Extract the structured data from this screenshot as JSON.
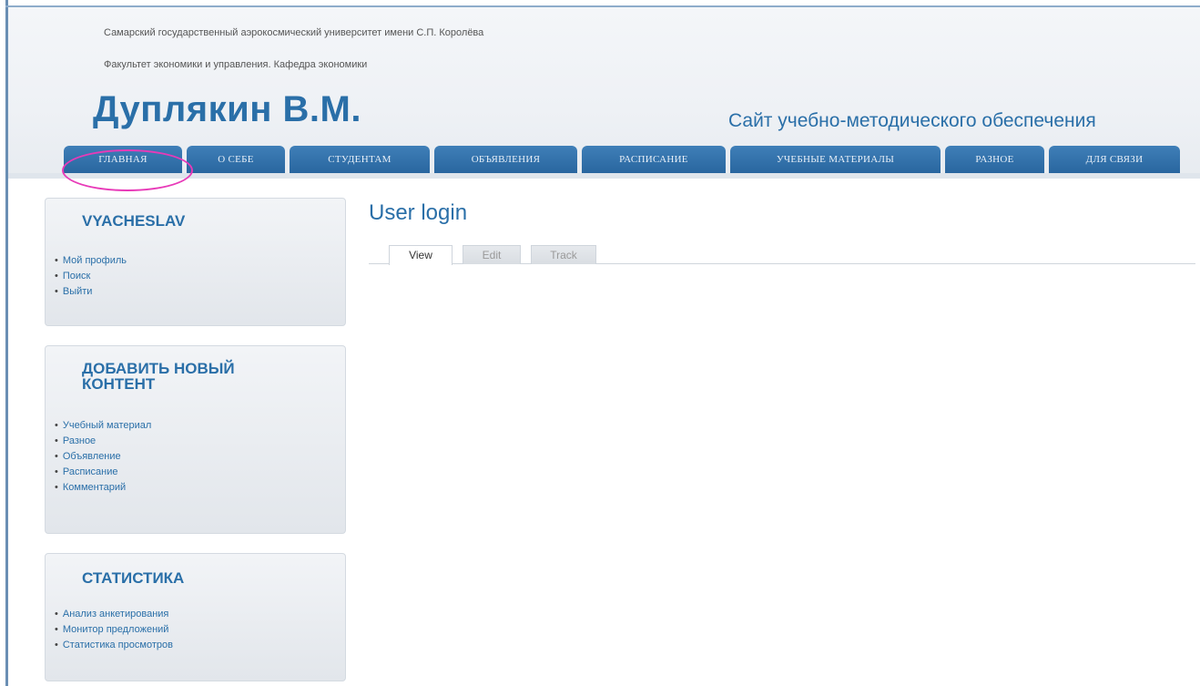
{
  "header": {
    "university": "Самарский государственный аэрокосмический университет имени С.П. Королёва",
    "faculty": "Факультет экономики и управления. Кафедра экономики",
    "site_name": "Дуплякин В.М.",
    "slogan": "Сайт учебно-методического обеспечения"
  },
  "nav": {
    "items": [
      {
        "label": "ГЛАВНАЯ"
      },
      {
        "label": "О СЕБЕ"
      },
      {
        "label": "СТУДЕНТАМ"
      },
      {
        "label": "ОБЪЯВЛЕНИЯ"
      },
      {
        "label": "РАСПИСАНИЕ"
      },
      {
        "label": "УЧЕБНЫЕ МАТЕРИАЛЫ"
      },
      {
        "label": "РАЗНОЕ"
      },
      {
        "label": "ДЛЯ СВЯЗИ"
      }
    ],
    "highlight_color": "#e83ab8"
  },
  "sidebar": {
    "user_block": {
      "title": "VYACHESLAV",
      "links": [
        "Мой профиль",
        "Поиск",
        "Выйти"
      ]
    },
    "add_content_block": {
      "title": "ДОБАВИТЬ НОВЫЙ КОНТЕНТ",
      "links": [
        "Учебный материал",
        "Разное",
        "Объявление",
        "Расписание",
        "Комментарий"
      ]
    },
    "stats_block": {
      "title": "СТАТИСТИКА",
      "links": [
        "Анализ анкетирования",
        "Монитор предложений",
        "Статистика просмотров"
      ]
    }
  },
  "main": {
    "title": "User login",
    "tabs": [
      {
        "label": "View",
        "active": true
      },
      {
        "label": "Edit",
        "active": false
      },
      {
        "label": "Track",
        "active": false
      }
    ]
  },
  "colors": {
    "accent": "#2a6fa8",
    "nav_bg": "#29669f"
  }
}
